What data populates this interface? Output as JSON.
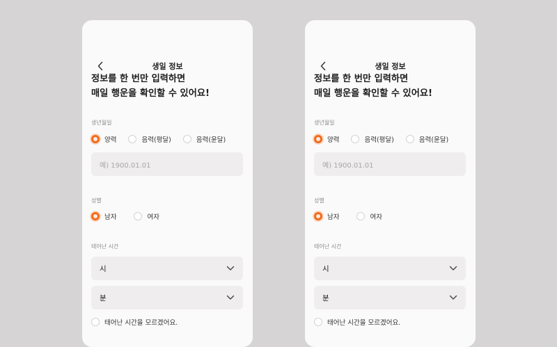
{
  "header": {
    "title": "생일 정보"
  },
  "headline": {
    "line1": "정보를 한 번만 입력하면",
    "line2": "매일 행운을 확인할 수 있어요!"
  },
  "birth": {
    "label": "생년월일",
    "options": [
      {
        "label": "양력",
        "checked": true
      },
      {
        "label": "음력(평달)",
        "checked": false
      },
      {
        "label": "음력(윤달)",
        "checked": false
      }
    ],
    "placeholder": "예) 1900.01.01"
  },
  "gender": {
    "label": "성별",
    "options": [
      {
        "label": "남자",
        "checked": true
      },
      {
        "label": "여자",
        "checked": false
      }
    ]
  },
  "birth_time": {
    "label": "태어난 시간",
    "hour_placeholder": "시",
    "minute_placeholder": "분",
    "unknown_label": "태어난 시간을 모르겠어요."
  },
  "colors": {
    "accent": "#f36a1d",
    "field_bg": "#efeded",
    "background": "#d6d4d4"
  },
  "icons": {
    "back": "chevron-left-icon",
    "dropdown": "chevron-down-icon"
  }
}
